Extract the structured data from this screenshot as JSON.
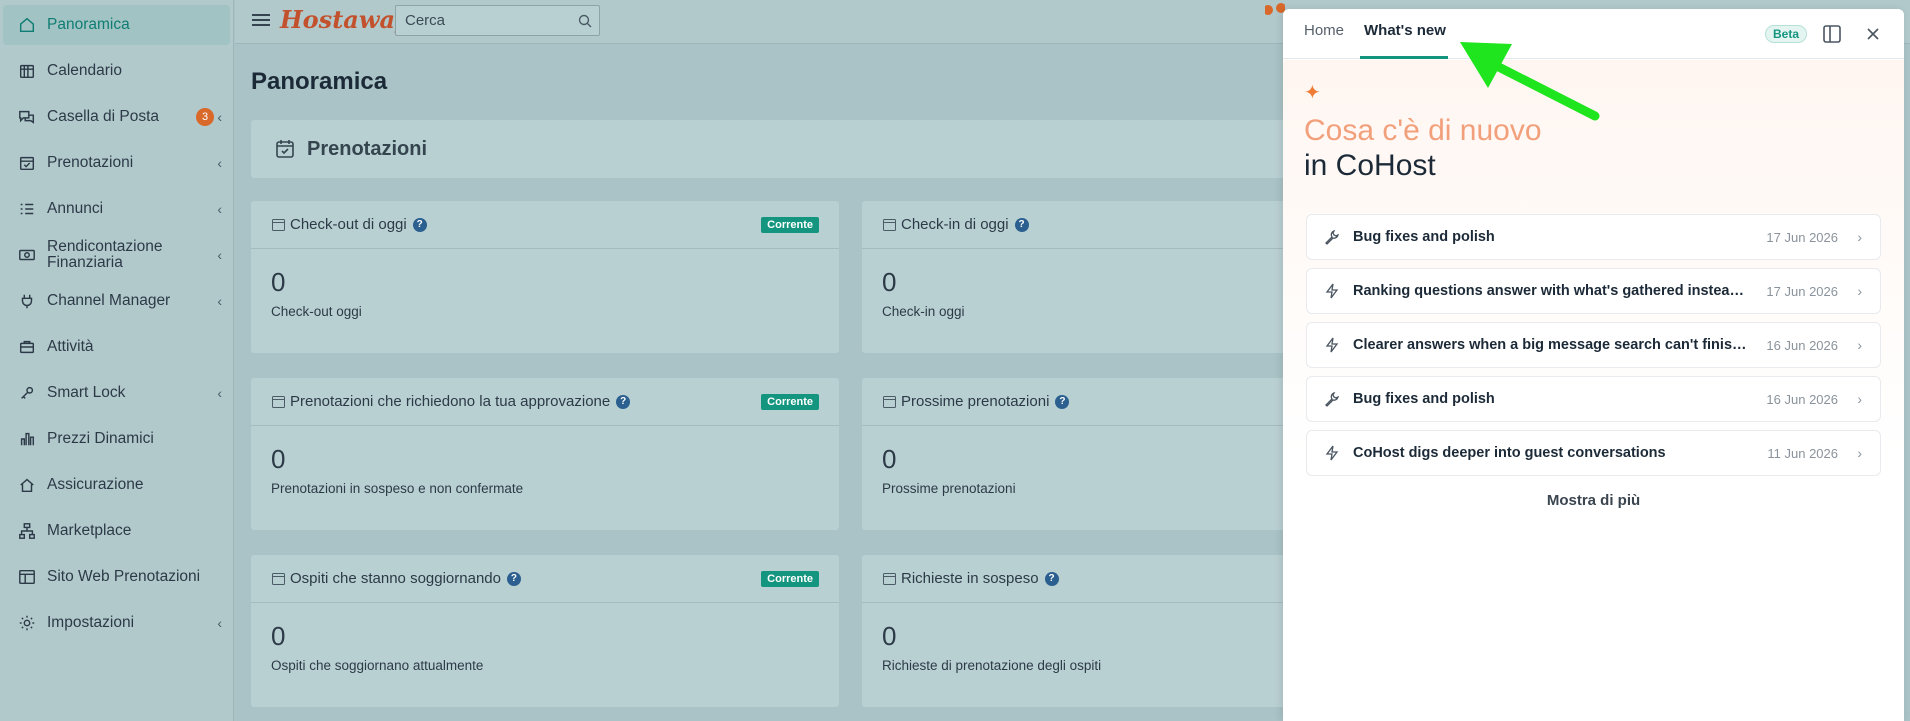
{
  "sidebar": {
    "items": [
      {
        "label": "Panoramica",
        "icon": "home-icon"
      },
      {
        "label": "Calendario",
        "icon": "calendar-icon"
      },
      {
        "label": "Casella di Posta",
        "icon": "chat-icon",
        "badge": "3"
      },
      {
        "label": "Prenotazioni",
        "icon": "calendar-check-icon"
      },
      {
        "label": "Annunci",
        "icon": "list-icon"
      },
      {
        "label": "Rendicontazione Finanziaria",
        "icon": "money-icon"
      },
      {
        "label": "Channel Manager",
        "icon": "plug-icon"
      },
      {
        "label": "Attività",
        "icon": "briefcase-icon"
      },
      {
        "label": "Smart Lock",
        "icon": "key-icon"
      },
      {
        "label": "Prezzi Dinamici",
        "icon": "bar-chart-icon"
      },
      {
        "label": "Assicurazione",
        "icon": "house-shield-icon"
      },
      {
        "label": "Marketplace",
        "icon": "sitemap-icon"
      },
      {
        "label": "Sito Web Prenotazioni",
        "icon": "layout-icon"
      },
      {
        "label": "Impostazioni",
        "icon": "gear-icon"
      }
    ]
  },
  "topbar": {
    "logo": "Hostaway",
    "search_placeholder": "Cerca"
  },
  "main": {
    "title": "Panoramica",
    "section_title": "Prenotazioni",
    "cards": [
      {
        "title": "Check-out di oggi",
        "tag": "Corrente",
        "value": "0",
        "sub": "Check-out oggi"
      },
      {
        "title": "Check-in di oggi",
        "tag": "",
        "value": "0",
        "sub": "Check-in oggi"
      },
      {
        "title": "Prenotazioni che richiedono la tua approvazione",
        "tag": "Corrente",
        "value": "0",
        "sub": "Prenotazioni in sospeso e non confermate"
      },
      {
        "title": "Prossime prenotazioni",
        "tag": "",
        "value": "0",
        "sub": "Prossime prenotazioni"
      },
      {
        "title": "Ospiti che stanno soggiornando",
        "tag": "Corrente",
        "value": "0",
        "sub": "Ospiti che soggiornano attualmente"
      },
      {
        "title": "Richieste in sospeso",
        "tag": "",
        "value": "0",
        "sub": "Richieste di prenotazione degli ospiti"
      }
    ]
  },
  "panel": {
    "tabs": [
      "Home",
      "What's new"
    ],
    "active_tab": "What's new",
    "beta": "Beta",
    "headline_1": "Cosa c'è di nuovo",
    "headline_2": "in CoHost",
    "news": [
      {
        "title": "Bug fixes and polish",
        "date": "17 Jun 2026",
        "icon": "wrench-icon"
      },
      {
        "title": "Ranking questions answer with what's gathered instead of stalling",
        "date": "17 Jun 2026",
        "icon": "bolt-icon"
      },
      {
        "title": "Clearer answers when a big message search can't finish in time",
        "date": "16 Jun 2026",
        "icon": "bolt-icon"
      },
      {
        "title": "Bug fixes and polish",
        "date": "16 Jun 2026",
        "icon": "wrench-icon"
      },
      {
        "title": "CoHost digs deeper into guest conversations",
        "date": "11 Jun 2026",
        "icon": "bolt-icon"
      }
    ],
    "more": "Mostra di più"
  },
  "colors": {
    "accent": "#14957f",
    "brand": "#c2522d",
    "badge": "#d8692a",
    "arrow": "#1ee51e"
  }
}
